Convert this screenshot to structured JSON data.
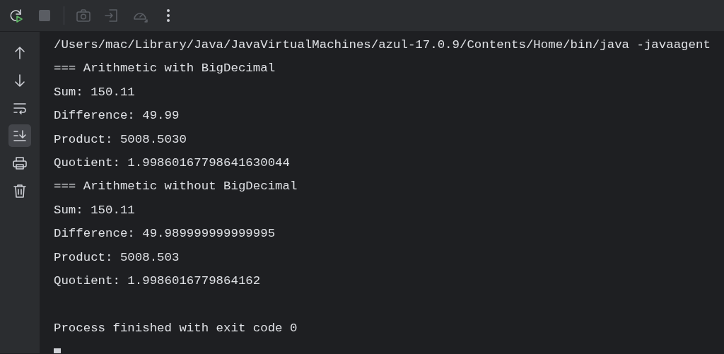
{
  "toolbar": [
    {
      "kind": "rerun",
      "disabled": false
    },
    {
      "kind": "stop",
      "disabled": true
    },
    {
      "kind": "separator"
    },
    {
      "kind": "camera",
      "disabled": true
    },
    {
      "kind": "exit",
      "disabled": true
    },
    {
      "kind": "gauge",
      "disabled": true
    },
    {
      "kind": "more",
      "disabled": false
    }
  ],
  "sidebar": [
    {
      "kind": "up",
      "selected": false
    },
    {
      "kind": "down",
      "selected": false
    },
    {
      "kind": "wrap",
      "selected": false
    },
    {
      "kind": "scroll-end",
      "selected": true
    },
    {
      "kind": "print",
      "selected": false
    },
    {
      "kind": "trash",
      "selected": false
    }
  ],
  "console": {
    "lines": [
      {
        "kind": "text",
        "text": "/Users/mac/Library/Java/JavaVirtualMachines/azul-17.0.9/Contents/Home/bin/java -javaagent"
      },
      {
        "kind": "text",
        "text": "=== Arithmetic with BigDecimal"
      },
      {
        "kind": "text",
        "text": "Sum: 150.11"
      },
      {
        "kind": "text",
        "text": "Difference: 49.99"
      },
      {
        "kind": "text",
        "text": "Product: 5008.5030"
      },
      {
        "kind": "text",
        "text": "Quotient: 1.99860167798641630044"
      },
      {
        "kind": "text",
        "text": "=== Arithmetic without BigDecimal"
      },
      {
        "kind": "text",
        "text": "Sum: 150.11"
      },
      {
        "kind": "text",
        "text": "Difference: 49.989999999999995"
      },
      {
        "kind": "text",
        "text": "Product: 5008.503"
      },
      {
        "kind": "text",
        "text": "Quotient: 1.9986016779864162"
      },
      {
        "kind": "blank"
      },
      {
        "kind": "text",
        "text": "Process finished with exit code 0"
      },
      {
        "kind": "cursor"
      }
    ]
  }
}
